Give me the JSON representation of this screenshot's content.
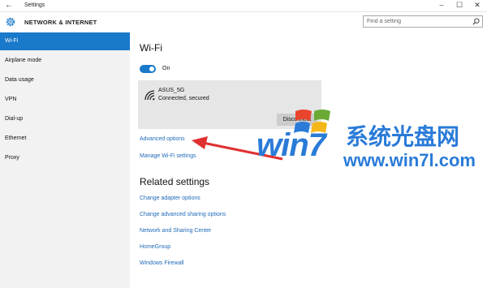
{
  "window": {
    "title": "Settings",
    "back_icon": "back-arrow-icon",
    "minimize_glyph": "–",
    "maximize_glyph": "☐",
    "close_glyph": "✕",
    "back_glyph": "←"
  },
  "header": {
    "title": "NETWORK & INTERNET",
    "icon": "gear-icon"
  },
  "search": {
    "placeholder": "Find a setting"
  },
  "sidebar": {
    "items": [
      {
        "label": "Wi-Fi",
        "active": true
      },
      {
        "label": "Airplane mode"
      },
      {
        "label": "Data usage"
      },
      {
        "label": "VPN"
      },
      {
        "label": "Dial-up"
      },
      {
        "label": "Ethernet"
      },
      {
        "label": "Proxy"
      }
    ]
  },
  "main": {
    "title": "Wi-Fi",
    "toggle": {
      "state": "On"
    },
    "network": {
      "name": "ASUS_5G",
      "status": "Connected, secured",
      "disconnect_label": "Disconnect"
    },
    "links": {
      "advanced": "Advanced options",
      "manage": "Manage Wi-Fi settings"
    },
    "related_title": "Related settings",
    "related_links": [
      "Change adapter options",
      "Change advanced sharing options",
      "Network and Sharing Center",
      "HomeGroup",
      "Windows Firewall"
    ]
  },
  "watermark": {
    "big": "win7",
    "chinese": "系统光盘网",
    "url": "www.win7l.com"
  },
  "colors": {
    "accent": "#1979ca",
    "link": "#1f69b8",
    "annotation_arrow": "#e03030",
    "watermark": "#2a7bd8"
  }
}
